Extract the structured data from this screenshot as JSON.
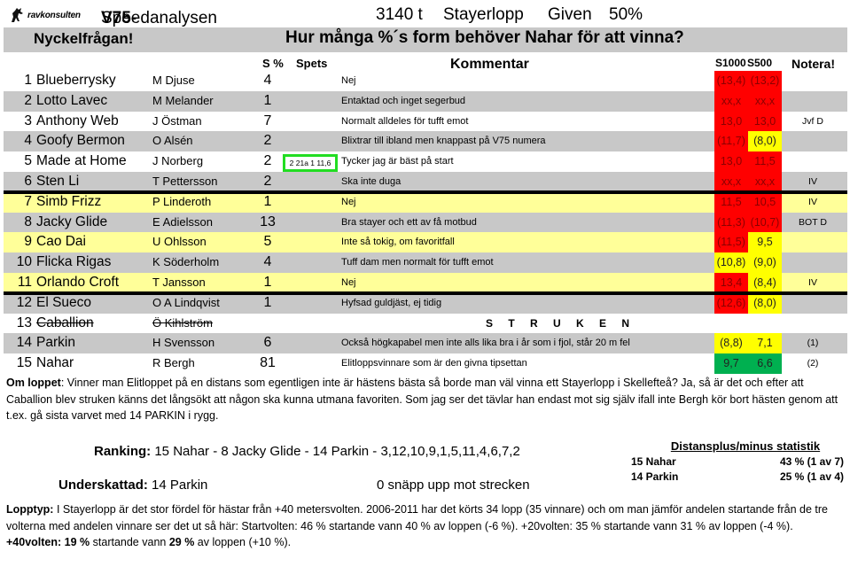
{
  "header": {
    "logo_text": "ravkonsulten",
    "race_bold": "V75-6",
    "race_name": "Speedanalysen",
    "distance": "3140 t",
    "race_type": "Stayerlopp",
    "given_label": "Given",
    "given_pct": "50%"
  },
  "question": {
    "label": "Nyckelfrågan!",
    "text": "Hur många %´s form behöver Nahar för att vinna?"
  },
  "columns": {
    "s_pct": "S %",
    "spets": "Spets",
    "kommentar": "Kommentar",
    "s1000": "S1000",
    "s500": "S500",
    "notera": "Notera!"
  },
  "horses": [
    {
      "num": "1",
      "name": "Blueberrysky",
      "driver": "M Djuse",
      "s_pct": "4",
      "comment": "Nej",
      "s1000": "(13,4)",
      "s500": "(13,2)",
      "s1000_color": "red",
      "s500_color": "red",
      "note": "",
      "row": "white"
    },
    {
      "num": "2",
      "name": "Lotto Lavec",
      "driver": "M Melander",
      "s_pct": "1",
      "comment": "Entaktad och inget segerbud",
      "s1000": "xx,x",
      "s500": "xx,x",
      "s1000_color": "red",
      "s500_color": "red",
      "note": "",
      "row": "gray"
    },
    {
      "num": "3",
      "name": "Anthony Web",
      "driver": "J Östman",
      "s_pct": "7",
      "comment": "Normalt alldeles för tufft emot",
      "s1000": "13,0",
      "s500": "13,0",
      "s1000_color": "red",
      "s500_color": "red",
      "note": "Jvf D",
      "row": "white"
    },
    {
      "num": "4",
      "name": "Goofy Bermon",
      "driver": "O Alsén",
      "s_pct": "2",
      "comment": "Blixtrar till ibland men knappast på V75 numera",
      "s1000": "(11,7)",
      "s500": "(8,0)",
      "s1000_color": "red",
      "s500_color": "yellow",
      "note": "",
      "row": "gray"
    },
    {
      "num": "5",
      "name": "Made at Home",
      "driver": "J Norberg",
      "s_pct": "2",
      "comment": "Tycker jag är bäst på start",
      "s1000": "13,0",
      "s500": "11,5",
      "s1000_color": "red",
      "s500_color": "red",
      "note": "",
      "row": "white"
    },
    {
      "num": "6",
      "name": "Sten Li",
      "driver": "T Pettersson",
      "s_pct": "2",
      "comment": "Ska inte duga",
      "s1000": "xx,x",
      "s500": "xx,x",
      "s1000_color": "red",
      "s500_color": "red",
      "note": "IV",
      "row": "gray"
    },
    {
      "num": "7",
      "name": "Simb Frizz",
      "driver": "P Linderoth",
      "s_pct": "1",
      "comment": "Nej",
      "s1000": "11,5",
      "s500": "10,5",
      "s1000_color": "red",
      "s500_color": "red",
      "note": "IV",
      "row": "yellow"
    },
    {
      "num": "8",
      "name": "Jacky Glide",
      "driver": "E Adielsson",
      "s_pct": "13",
      "comment": "Bra stayer och ett av få motbud",
      "s1000": "(11,3)",
      "s500": "(10,7)",
      "s1000_color": "red",
      "s500_color": "red",
      "note": "BOT D",
      "row": "gray"
    },
    {
      "num": "9",
      "name": "Cao Dai",
      "driver": "U Ohlsson",
      "s_pct": "5",
      "comment": "Inte så tokig, om favoritfall",
      "s1000": "(11,5)",
      "s500": "9,5",
      "s1000_color": "red",
      "s500_color": "yellow",
      "note": "",
      "row": "yellow"
    },
    {
      "num": "10",
      "name": "Flicka Rigas",
      "driver": "K Söderholm",
      "s_pct": "4",
      "comment": "Tuff dam men normalt för tufft emot",
      "s1000": "(10,8)",
      "s500": "(9,0)",
      "s1000_color": "yellow",
      "s500_color": "yellow",
      "note": "",
      "row": "gray"
    },
    {
      "num": "11",
      "name": "Orlando Croft",
      "driver": "T Jansson",
      "s_pct": "1",
      "comment": "Nej",
      "s1000": "13,4",
      "s500": "(8,4)",
      "s1000_color": "red",
      "s500_color": "yellow",
      "note": "IV",
      "row": "yellow"
    },
    {
      "num": "12",
      "name": "El Sueco",
      "driver": "O A Lindqvist",
      "s_pct": "1",
      "comment": "Hyfsad guldjäst, ej tidig",
      "s1000": "(12,6)",
      "s500": "(8,0)",
      "s1000_color": "red",
      "s500_color": "yellow",
      "note": "",
      "row": "gray"
    },
    {
      "num": "13",
      "name": "Caballion",
      "driver": "Ö Kihlström",
      "s_pct": "",
      "comment": "",
      "s1000": "",
      "s500": "",
      "s1000_color": "none",
      "s500_color": "none",
      "note": "",
      "row": "white",
      "scratched": true
    },
    {
      "num": "14",
      "name": "Parkin",
      "driver": "H Svensson",
      "s_pct": "6",
      "comment": "Också högkapabel men inte alls lika bra i år som i fjol, står 20 m fel",
      "s1000": "(8,8)",
      "s500": "7,1",
      "s1000_color": "yellow",
      "s500_color": "yellow",
      "note": "(1)",
      "row": "gray"
    },
    {
      "num": "15",
      "name": "Nahar",
      "driver": "R Bergh",
      "s_pct": "81",
      "comment": "Elitloppsvinnare som är den givna tipsettan",
      "s1000": "9,7",
      "s500": "6,6",
      "s1000_color": "green",
      "s500_color": "green",
      "note": "(2)",
      "row": "white"
    }
  ],
  "struken_label": "S T R U K E N",
  "spets_box_text": "2 21a 1 11,6",
  "om_loppet": {
    "label": "Om loppet",
    "text": ": Vinner man Elitloppet på en distans som egentligen inte är hästens bästa så borde man väl vinna ett Stayerlopp i Skellefteå? Ja, så är det och efter att Caballion blev struken känns det långsökt att någon ska kunna utmana favoriten. Som jag ser det tävlar han endast mot sig själv ifall inte Bergh kör bort hästen genom att t.ex. gå sista varvet med 14 PARKIN i rygg."
  },
  "ranking": {
    "label": "Ranking:",
    "text": "15 Nahar - 8 Jacky Glide - 14 Parkin - 3,12,10,9,1,5,11,4,6,7,2"
  },
  "underskattad": {
    "label": "Underskattad:",
    "text": "14 Parkin",
    "note": "0 snäpp upp mot strecken"
  },
  "distance_stats": {
    "title": "Distansplus/minus statistik",
    "rows": [
      {
        "horse": "15 Nahar",
        "value": "43 % (1 av 7)"
      },
      {
        "horse": "14 Parkin",
        "value": "25 % (1 av 4)"
      }
    ]
  },
  "lopptyp": {
    "label": "Lopptyp:",
    "text1": " I Stayerlopp är det stor fördel för hästar från +40 metersvolten. 2006-2011 har det körts 34 lopp (35 vinnare) och om man jämför andelen startande från de tre volterna med andelen vinnare ser det ut så här: Startvolten: 46 % startande vann 40 % av loppen (-6 %). +20volten: 35 % startande vann 31 % av loppen (-4 %).",
    "volt40_label": "+40volten:",
    "volt40_start_pct": "19 %",
    "text2": " startande vann ",
    "volt40_win_pct": "29 %",
    "text3": " av loppen (+10 %)."
  }
}
